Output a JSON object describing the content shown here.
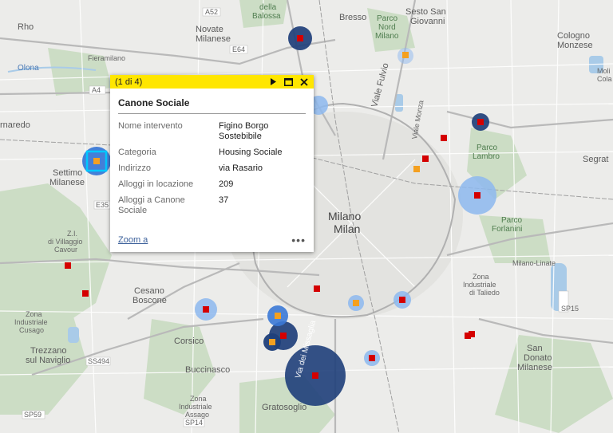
{
  "popup": {
    "count": "(1 di 4)",
    "title": "Canone Sociale",
    "fields": [
      {
        "key": "Nome intervento",
        "value": "Figino Borgo Sostebibile"
      },
      {
        "key": "Categoria",
        "value": "Housing Sociale"
      },
      {
        "key": "Indirizzo",
        "value": "via Rasario"
      },
      {
        "key": "Alloggi in locazione",
        "value": "209"
      },
      {
        "key": "Alloggi a Canone Sociale",
        "value": "37"
      }
    ],
    "zoom_label": "Zoom a",
    "icons": {
      "next": "play-next-icon",
      "maximize": "maximize-icon",
      "close": "close-icon",
      "more": "more-options-icon"
    }
  },
  "map": {
    "places": {
      "rho": "Rho",
      "olona": "Olona",
      "novate": "Novate Milanese",
      "balossa": "della Balossa",
      "bresso": "Bresso",
      "parco_nord": "Parco Nord Milano",
      "sesto": "Sesto San Giovanni",
      "cologno": "Cologno Monzese",
      "molino": "Moli Cola",
      "pero_fragment": "Fieramilano",
      "rnaredo": "rnaredo",
      "settimo": "Settimo Milanese",
      "viale_fulvio": "Viale Fulvio",
      "viale_monza": "Viale Monza",
      "parco_lambro": "Parco Lambro",
      "segrate": "Segrat",
      "milano": "Milano",
      "milan": "Milan",
      "parco_forlanini": "Parco Forlanini",
      "milano_linate": "Milano-Linate",
      "villaggio_cavour": "Z.I. di Villaggio Cavour",
      "cesano": "Cesano Boscone",
      "cusago": "Zona Industriale Cusago",
      "corsico": "Corsico",
      "trezzano": "Trezzano sul Naviglio",
      "buccinasco": "Buccinasco",
      "zona_assago": "Zona Industriale Assago",
      "gratosoglio": "Gratosoglio",
      "taliedo": "Zona Industriale di Taliedo",
      "san_donato": "San Donato Milanese",
      "via_de_missaglia": "Via dei Missaglia"
    },
    "roads": {
      "a52": "A52",
      "e64": "E64",
      "a4": "A4",
      "e35": "E35",
      "ss494": "SS494",
      "sp59": "SP59",
      "sp15": "SP15",
      "sp14": "SP14"
    },
    "colors": {
      "dark_blue": "#1f3f7a",
      "mid_blue": "#3b79d6",
      "light_blue": "#8db8ef",
      "red": "#d40000",
      "orange": "#f4a020",
      "highlight": "#00c8ff",
      "popup_header": "#ffe600"
    }
  }
}
